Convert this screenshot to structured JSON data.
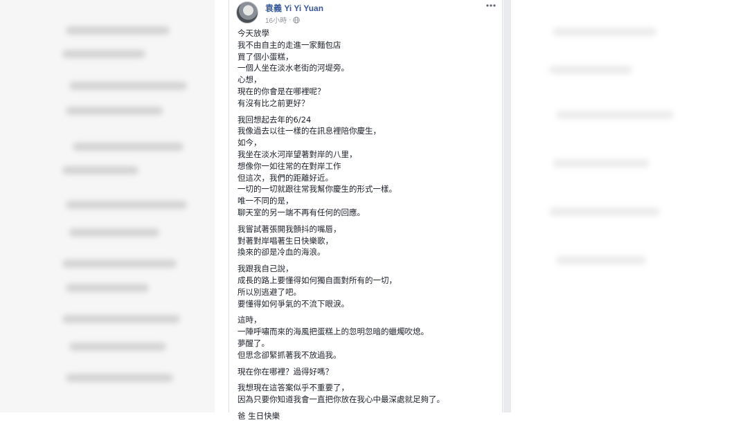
{
  "post": {
    "author": "袁義 Yi Yi Yuan",
    "time": "16小時",
    "separator": "·",
    "icons": {
      "privacy": "globe-icon",
      "menu": "more-options-icon"
    },
    "paragraphs": [
      [
        "今天放學",
        "我不由自主的走進一家麵包店",
        "買了個小蛋糕，",
        "一個人坐在淡水老街的河堤旁。",
        "心想，",
        "現在的你會是在哪裡呢？",
        "有沒有比之前更好？"
      ],
      [
        "我回想起去年的6/24",
        "我像過去以往一樣的在訊息裡陪你慶生，",
        "如今，",
        "我坐在淡水河岸望著對岸的八里，",
        "想像你一如往常的在對岸工作",
        "但這次，我們的距離好近。",
        "一切的一切就跟往常我幫你慶生的形式一樣。",
        "唯一不同的是，",
        "聊天室的另一端不再有任何的回應。"
      ],
      [
        "我嘗試著張開我顫抖的嘴唇，",
        "對著對岸唱著生日快樂歌，",
        "換來的卻是冷血的海浪。"
      ],
      [
        "我跟我自己說，",
        "成長的路上要懂得如何獨自面對所有的一切，",
        "所以別逃避了吧。",
        "要懂得如何爭氣的不流下眼淚。"
      ],
      [
        "這時，",
        "一陣呼嘯而來的海風把蛋糕上的忽明忽暗的蠟燭吹熄。",
        "夢醒了。",
        "但思念卻緊抓著我不放過我。"
      ],
      [
        "現在你在哪裡？過得好嗎？"
      ],
      [
        "我想現在這答案似乎不重要了，",
        "因為只要你知道我會一直把你放在我心中最深處就足夠了。"
      ],
      [
        "爸 生日快樂"
      ]
    ]
  }
}
